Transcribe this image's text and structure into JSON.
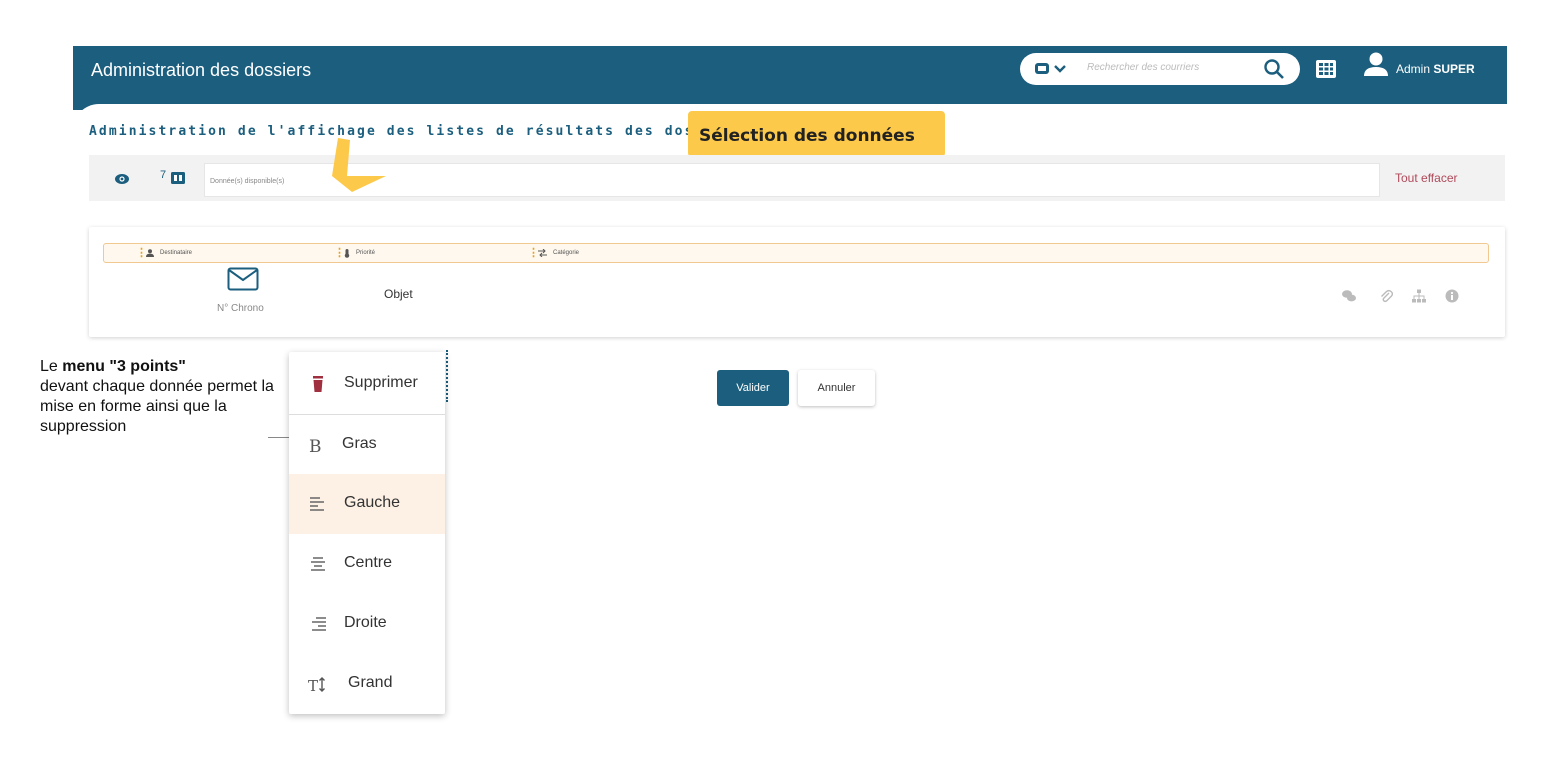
{
  "header": {
    "title": "Administration des dossiers",
    "search_placeholder": "Rechercher des courriers",
    "user_prefix": "Admin",
    "user_name": "SUPER"
  },
  "page": {
    "title": "Administration de l'affichage des listes de résultats des dossiers"
  },
  "callout": {
    "label": "Sélection des données"
  },
  "toolbar": {
    "count": "7",
    "data_placeholder": "Donnée(s) disponible(s)",
    "clear_label": "Tout effacer"
  },
  "preview": {
    "fields": [
      {
        "icon": "user-icon",
        "label": "Destinataire"
      },
      {
        "icon": "thermometer-icon",
        "label": "Priorité"
      },
      {
        "icon": "swap-icon",
        "label": "Catégorie"
      }
    ],
    "chrono_label": "N° Chrono",
    "object_label": "Objet",
    "actions": [
      "comments-icon",
      "paperclip-icon",
      "sitemap-icon",
      "info-icon"
    ]
  },
  "buttons": {
    "validate": "Valider",
    "cancel": "Annuler"
  },
  "annotation": {
    "prefix": "Le ",
    "bold": "menu \"3 points\"",
    "rest": "devant chaque donnée permet la mise en forme ainsi que la suppression"
  },
  "menu": {
    "items": [
      {
        "label": "Supprimer",
        "icon": "trash-icon"
      },
      {
        "label": "Gras",
        "icon": "bold-icon"
      },
      {
        "label": "Gauche",
        "icon": "align-left-icon",
        "highlighted": true
      },
      {
        "label": "Centre",
        "icon": "align-center-icon"
      },
      {
        "label": "Droite",
        "icon": "align-right-icon"
      },
      {
        "label": "Grand",
        "icon": "text-size-icon"
      }
    ]
  },
  "colors": {
    "primary": "#1b5e7e",
    "accent": "#fcc94a",
    "danger": "#b04a5a",
    "highlight": "#fdf0e4"
  }
}
